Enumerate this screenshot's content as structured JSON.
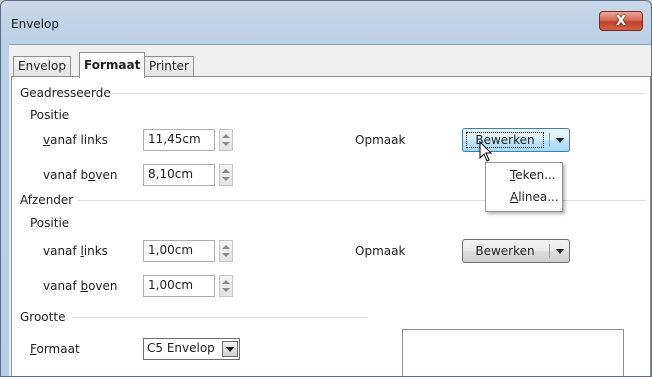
{
  "window": {
    "title": "Envelop",
    "close_glyph": "X"
  },
  "tabs": [
    {
      "label": "Envelop",
      "active": false
    },
    {
      "label": "Formaat",
      "active": true
    },
    {
      "label": "Printer",
      "active": false
    }
  ],
  "addressee": {
    "section": "Geadresseerde",
    "position": "Positie",
    "from_left": {
      "pre": "",
      "key": "v",
      "post": "anaf links",
      "value": "11,45cm"
    },
    "from_top": {
      "pre": "vanaf b",
      "key": "o",
      "post": "ven",
      "value": "8,10cm"
    },
    "format_label": "Opmaak",
    "edit_button": "Bewerken",
    "menu": [
      {
        "key": "T",
        "post": "eken..."
      },
      {
        "key": "A",
        "post": "linea..."
      }
    ]
  },
  "sender": {
    "section": "Afzender",
    "position": "Positie",
    "from_left": {
      "pre": "vanaf ",
      "key": "l",
      "post": "inks",
      "value": "1,00cm"
    },
    "from_top": {
      "pre": "vanaf ",
      "key": "b",
      "post": "oven",
      "value": "1,00cm"
    },
    "format_label": "Opmaak",
    "edit_button": "Bewerken"
  },
  "size": {
    "section": "Grootte",
    "format": {
      "key": "F",
      "post": "ormaat",
      "value": "C5 Envelop"
    }
  },
  "colors": {
    "titlebar": "#bcd0e6",
    "close": "#c2412a",
    "hot_button": "#bee6fd"
  }
}
